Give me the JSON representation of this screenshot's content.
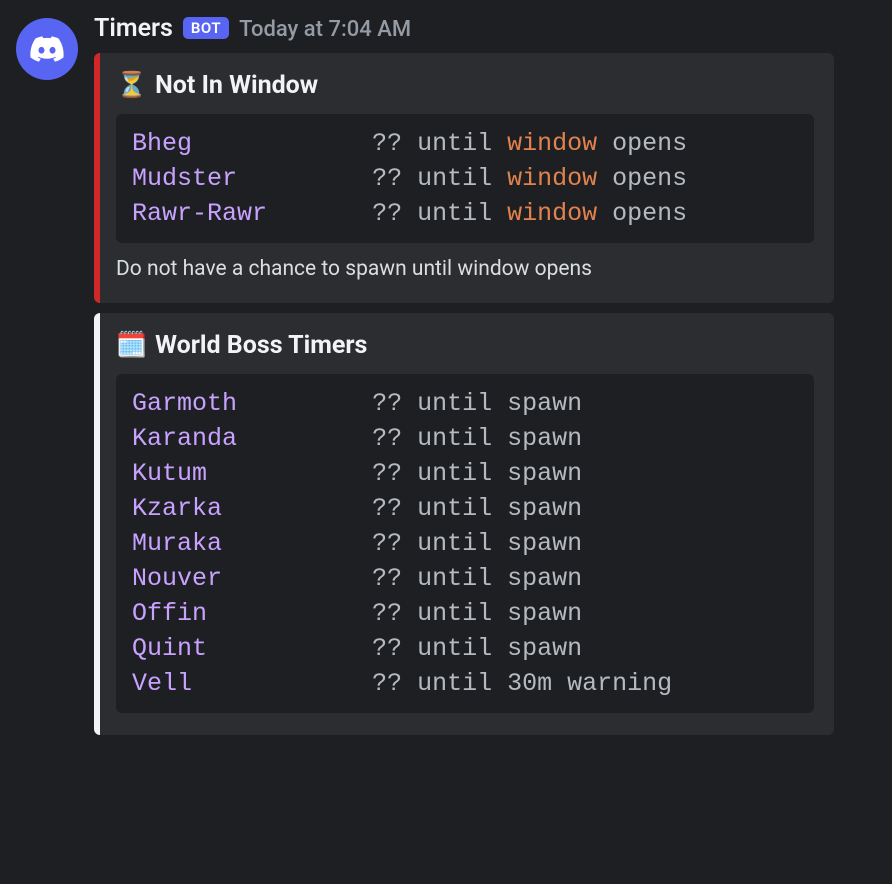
{
  "author": {
    "name": "Timers",
    "badge": "BOT",
    "timestamp": "Today at 7:04 AM"
  },
  "embeds": [
    {
      "accent": "red",
      "emoji": "⏳",
      "title": "Not In Window",
      "rows": [
        {
          "name": "Bheg",
          "pad": "            ",
          "q": "?? ",
          "mid": "until ",
          "hl": "window",
          "tail": " opens"
        },
        {
          "name": "Mudster",
          "pad": "         ",
          "q": "?? ",
          "mid": "until ",
          "hl": "window",
          "tail": " opens"
        },
        {
          "name": "Rawr-Rawr",
          "pad": "       ",
          "q": "?? ",
          "mid": "until ",
          "hl": "window",
          "tail": " opens"
        }
      ],
      "footer": "Do not have a chance to spawn until window opens"
    },
    {
      "accent": "white",
      "emoji": "🗓️",
      "title": "World Boss Timers",
      "rows": [
        {
          "name": "Garmoth",
          "pad": "         ",
          "q": "?? ",
          "mid": "until ",
          "hl": "",
          "tail": "spawn"
        },
        {
          "name": "Karanda",
          "pad": "         ",
          "q": "?? ",
          "mid": "until ",
          "hl": "",
          "tail": "spawn"
        },
        {
          "name": "Kutum",
          "pad": "           ",
          "q": "?? ",
          "mid": "until ",
          "hl": "",
          "tail": "spawn"
        },
        {
          "name": "Kzarka",
          "pad": "          ",
          "q": "?? ",
          "mid": "until ",
          "hl": "",
          "tail": "spawn"
        },
        {
          "name": "Muraka",
          "pad": "          ",
          "q": "?? ",
          "mid": "until ",
          "hl": "",
          "tail": "spawn"
        },
        {
          "name": "Nouver",
          "pad": "          ",
          "q": "?? ",
          "mid": "until ",
          "hl": "",
          "tail": "spawn"
        },
        {
          "name": "Offin",
          "pad": "           ",
          "q": "?? ",
          "mid": "until ",
          "hl": "",
          "tail": "spawn"
        },
        {
          "name": "Quint",
          "pad": "           ",
          "q": "?? ",
          "mid": "until ",
          "hl": "",
          "tail": "spawn"
        },
        {
          "name": "Vell",
          "pad": "            ",
          "q": "?? ",
          "mid": "until ",
          "hl": "",
          "tail": "30m warning"
        }
      ],
      "footer": ""
    }
  ]
}
